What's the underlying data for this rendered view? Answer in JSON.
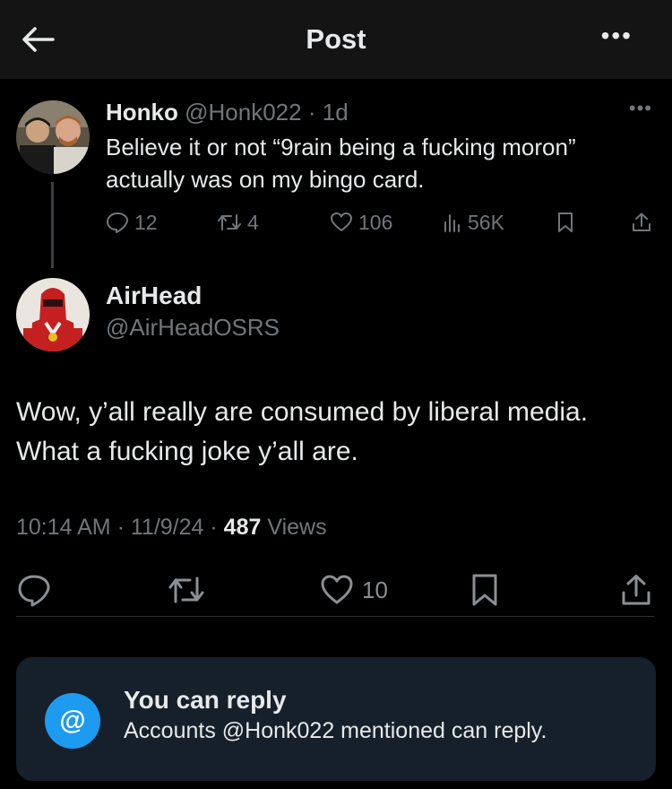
{
  "header": {
    "title": "Post",
    "more_label": "•••"
  },
  "reply_tweet": {
    "name": "Honko",
    "handle": "@Honk022",
    "separator": "·",
    "time": "1d",
    "more_label": "•••",
    "text_line1": "Believe it or not “9rain being a fucking moron”",
    "text_line2": "actually was on my bingo card.",
    "stats": {
      "replies": "12",
      "reposts": "4",
      "likes": "106",
      "views": "56K"
    }
  },
  "main_tweet": {
    "name": "AirHead",
    "handle": "@AirHeadOSRS",
    "text_line1": "Wow, y’all really are consumed by liberal media.",
    "text_line2": "What a fucking joke y’all are.",
    "time": "10:14 AM",
    "date": "11/9/24",
    "separator": "·",
    "views_count": "487",
    "views_label": "Views",
    "likes": "10"
  },
  "reply_restriction": {
    "icon_label": "@",
    "title": "You can reply",
    "subtitle": "Accounts @Honk022 mentioned can reply."
  },
  "colors": {
    "background": "#000000",
    "header_bg": "#141414",
    "muted": "#71767b",
    "accent": "#1d9bf0",
    "card_bg": "#15202b"
  }
}
